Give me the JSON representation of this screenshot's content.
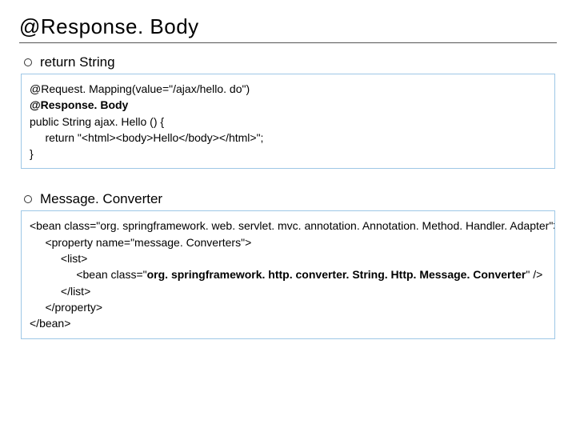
{
  "title": "@Response. Body",
  "section1": {
    "bullet": "return String",
    "code": [
      {
        "text": "@Request. Mapping(value=\"/ajax/hello. do\")",
        "bold": false
      },
      {
        "text": "@Response. Body",
        "bold": true
      },
      {
        "text": "public String ajax. Hello () {",
        "bold": false
      },
      {
        "text": "     return \"<html><body>Hello</body></html>\";",
        "bold": false
      },
      {
        "text": "}",
        "bold": false
      }
    ]
  },
  "section2": {
    "bullet": "Message. Converter",
    "code": [
      {
        "text": "<bean class=\"org. springframework. web. servlet. mvc. annotation. Annotation. Method. Handler. Adapter\">",
        "bold": false
      },
      {
        "text": "     <property name=\"message. Converters\">",
        "bold": false
      },
      {
        "text": "          <list>",
        "bold": false
      },
      {
        "pre": "               <bean class=\"",
        "boldText": "org. springframework. http. converter. String. Http. Message. Converter",
        "post": "\" />"
      },
      {
        "text": "          </list>",
        "bold": false
      },
      {
        "text": "     </property>",
        "bold": false
      },
      {
        "text": "</bean>",
        "bold": false
      }
    ]
  }
}
